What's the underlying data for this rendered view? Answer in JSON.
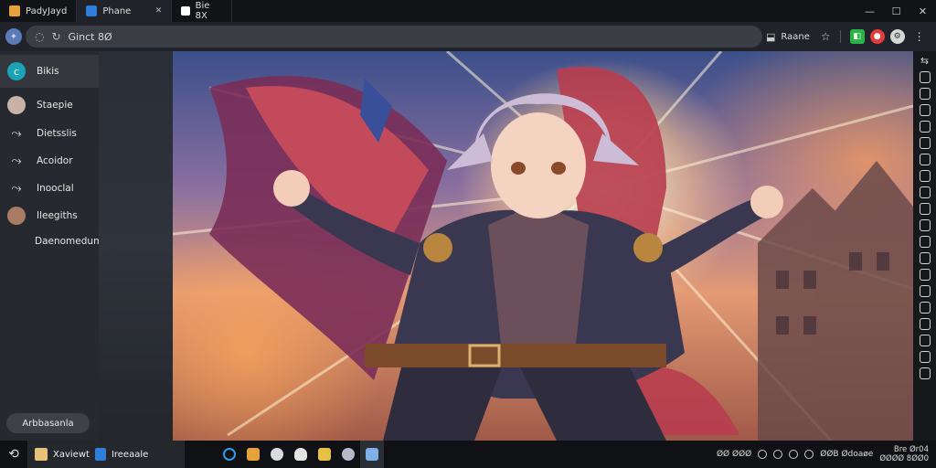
{
  "tabs": [
    {
      "label": "PadyJayd",
      "icon": "app-icon",
      "color": "#e3a33a"
    },
    {
      "label": "Phane",
      "icon": "app-icon",
      "color": "#2f7fd8"
    },
    {
      "label": "Bie 8X",
      "icon": "terminal-icon",
      "color": "#ffffff"
    }
  ],
  "window_controls": {
    "minimize": "—",
    "maximize": "☐",
    "close": "✕"
  },
  "toolbar": {
    "address": "Ginct 8Ø",
    "profile_label": "Raane"
  },
  "sidebar": {
    "items": [
      {
        "label": "Bikis",
        "icon": "c-logo-icon"
      },
      {
        "label": "Staepie",
        "icon": "avatar-icon"
      },
      {
        "label": "Dietsslis",
        "icon": "pin-icon"
      },
      {
        "label": "Acoidor",
        "icon": "pin-icon"
      },
      {
        "label": "Inooclal",
        "icon": "pin-icon"
      },
      {
        "label": "Ileegiths",
        "icon": "avatar-icon"
      },
      {
        "label": "Daenomedum",
        "icon": ""
      }
    ],
    "footer_button": "Arbbasanla"
  },
  "taskbar": {
    "window_label_1": "Xaviewt",
    "window_label_2": "Ireeaale",
    "tray_text": "ØØ ØØØ",
    "tray_status": "ØØB Ødoaøe",
    "clock_time": "Bre Ør04",
    "clock_date": "ØØØØ 8ØØ0"
  },
  "colors": {
    "accent": "#1aa3b6",
    "green_badge": "#2bb34a",
    "red_badge": "#e23b3b"
  }
}
